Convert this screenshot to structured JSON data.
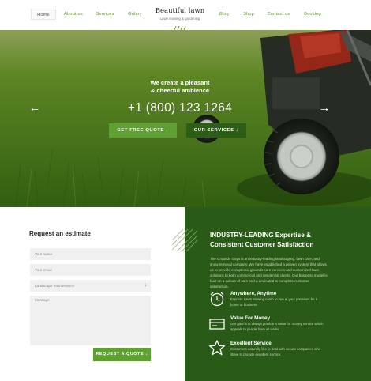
{
  "header": {
    "nav_left": [
      "Home",
      "About us",
      "Services",
      "Galery"
    ],
    "nav_right": [
      "Blog",
      "Shop",
      "Contact us",
      "Booking"
    ],
    "brand_title": "Beautiful lawn",
    "brand_subtitle": "Lawn mowing & gardening"
  },
  "hero": {
    "lead_line1": "We create a pleasant",
    "lead_line2": "& cheerful ambience",
    "phone": "+1 (800) 123 1264",
    "prev_arrow": "←",
    "next_arrow": "→",
    "quote_button": "GET FREE QUOTE ↓",
    "services_button": "OUR SERVICES ↓"
  },
  "estimate": {
    "title": "Request an estimate",
    "name_placeholder": "Your name",
    "email_placeholder": "Your email",
    "service_select": "Landscape maintenance",
    "message_placeholder": "Message",
    "submit_button": "REQUEST A QUOTE ↓"
  },
  "features": {
    "title_line1": "INDUSTRY-LEADING Expertise &",
    "title_line2": "Consistent Customer Satisfaction",
    "intro": "The Grounds Guys is an industry-leading landscaping, lawn care, and snow removal company. We have established a proven system that allows us to provide exceptional grounds care services and customized lawn solutions to both commercial and residential clients. Our business model is built on a culture of care and a dedicated to complete customer satisfaction.",
    "items": [
      {
        "name": "Anywhere, Anytime",
        "desc": "Express Lawn Mowing come to you at your premises be it home or business",
        "icon": "alarm-clock-icon"
      },
      {
        "name": "Value For Money",
        "desc": "Our goal is to always provide a value for money service which appeals to people from all walks",
        "icon": "money-icon"
      },
      {
        "name": "Excellent Service",
        "desc": "Customers naturally like to deal with secure companies who strive to provide excellent service.",
        "icon": "star-icon"
      }
    ]
  },
  "colors": {
    "accent_green": "#5fa033",
    "dark_green": "#2a5a18",
    "nav_green": "#5d8f2b"
  }
}
